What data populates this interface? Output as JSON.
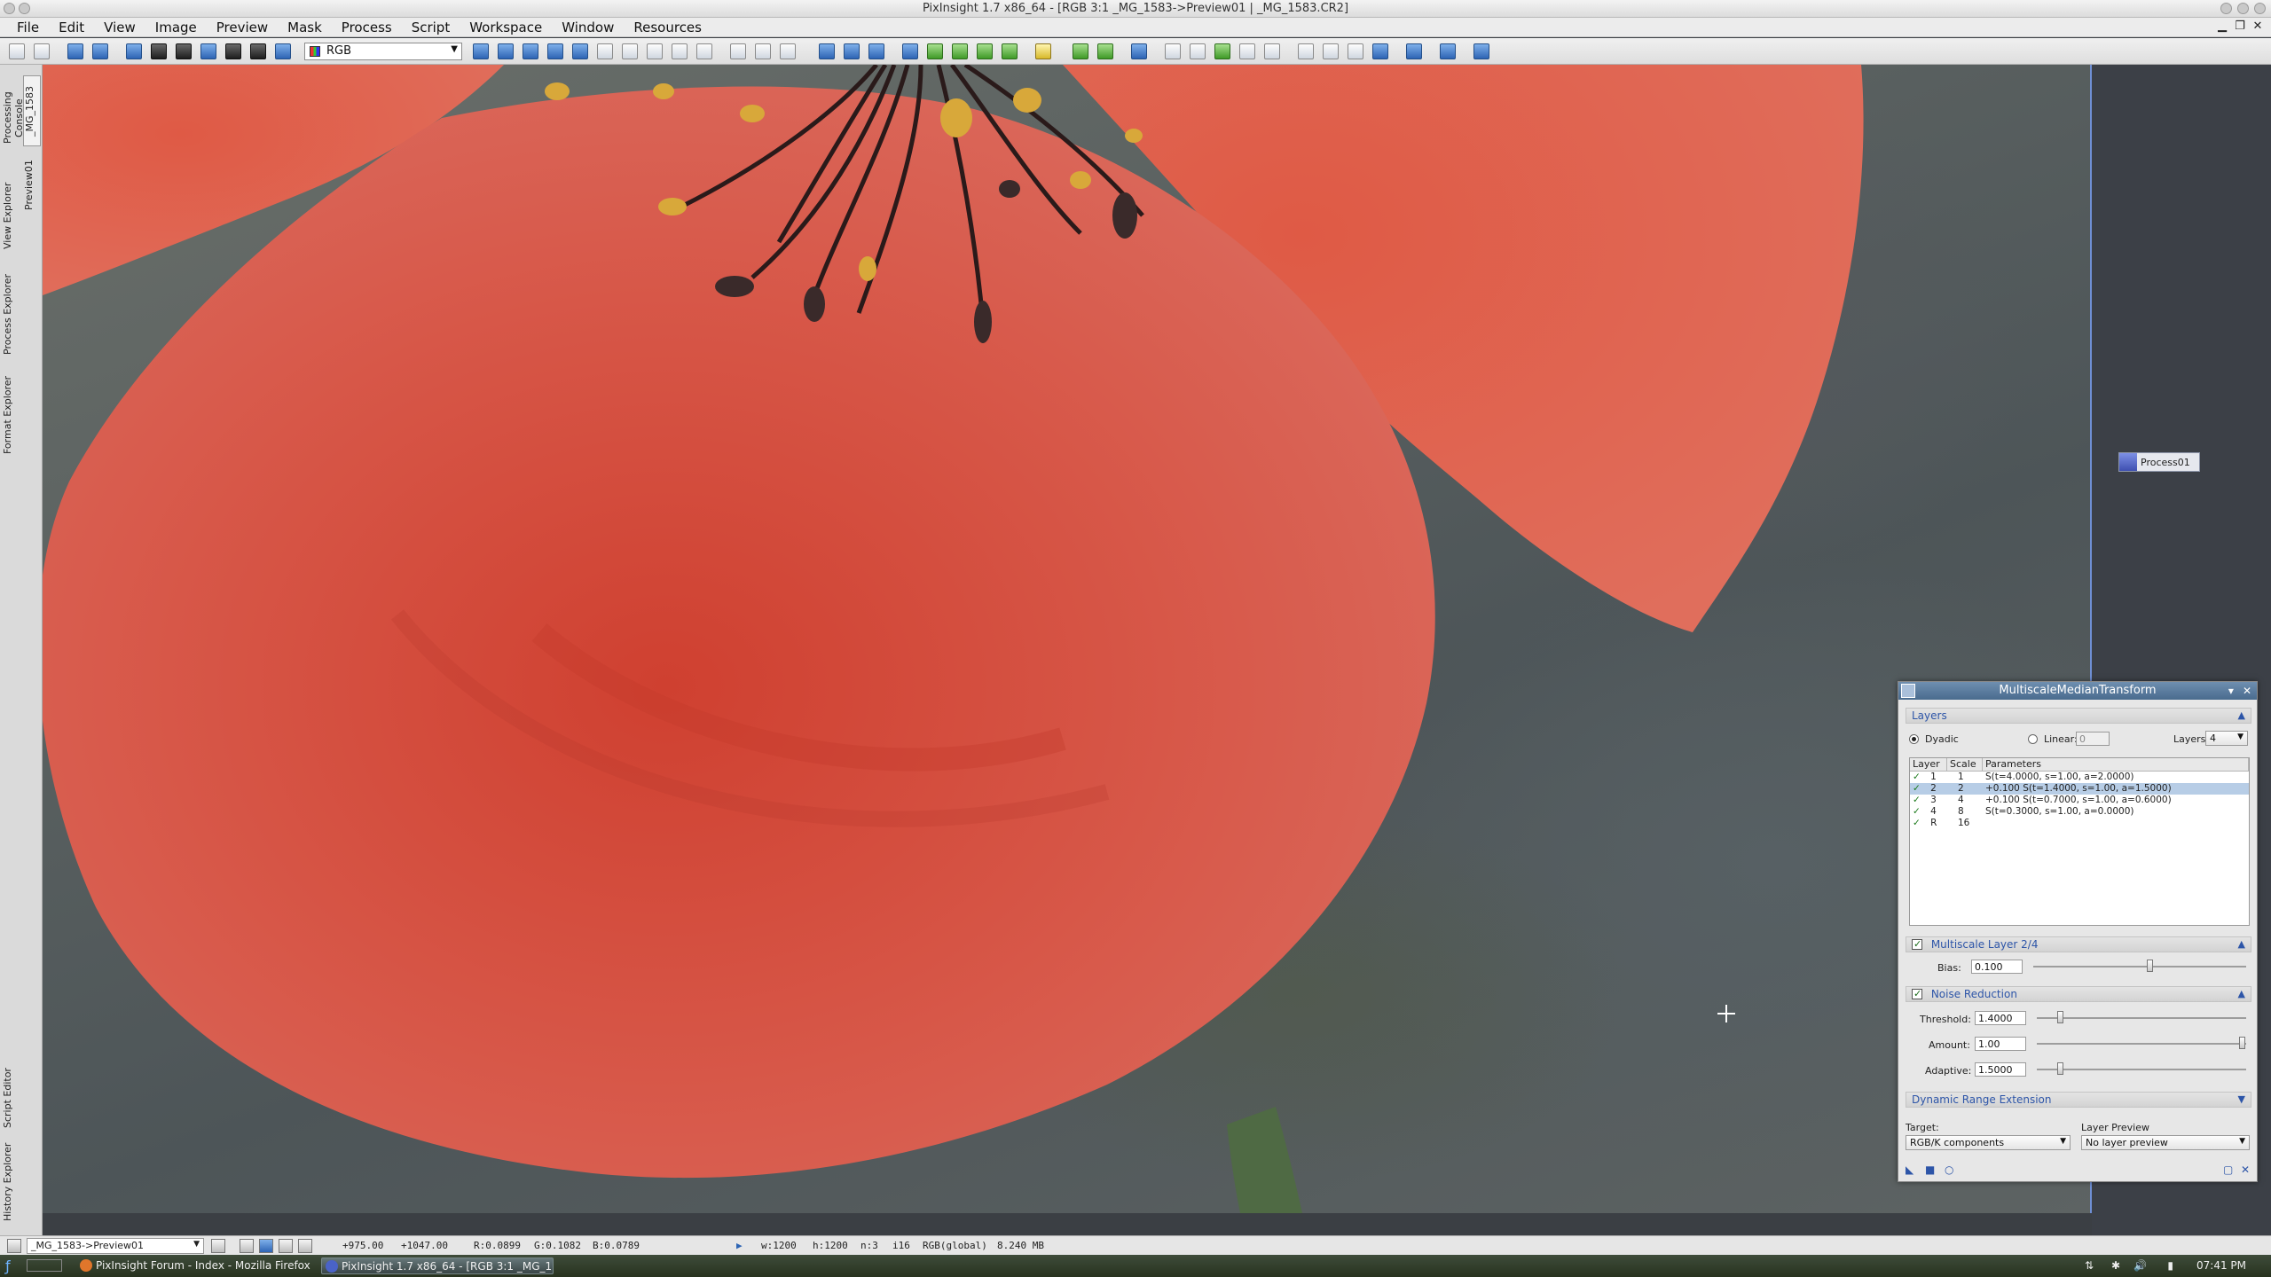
{
  "window": {
    "title": "PixInsight 1.7 x86_64 - [RGB 3:1 _MG_1583->Preview01 | _MG_1583.CR2]"
  },
  "menubar": {
    "items": [
      "File",
      "Edit",
      "View",
      "Image",
      "Preview",
      "Mask",
      "Process",
      "Script",
      "Workspace",
      "Window",
      "Resources"
    ]
  },
  "toolbar": {
    "channel_select": "RGB"
  },
  "left_tabs": {
    "processing_console": "Processing Console",
    "view_explorer": "View Explorer",
    "process_explorer": "Process Explorer",
    "format_explorer": "Format Explorer",
    "script_editor": "Script Editor",
    "history_explorer": "History Explorer",
    "doc_tab": "_MG_1583",
    "preview_tab": "Preview01"
  },
  "workspace": {
    "process_icon_label": "Process01"
  },
  "mmt": {
    "title": "MultiscaleMedianTransform",
    "layers_section": "Layers",
    "dyadic_label": "Dyadic",
    "linear_label": "Linear:",
    "linear_value": "0",
    "layers_label": "Layers:",
    "layers_value": "4",
    "table_headers": [
      "Layer",
      "Scale",
      "Parameters"
    ],
    "table_rows": [
      {
        "check": "✓",
        "layer": "1",
        "scale": "1",
        "params": "S(t=4.0000, s=1.00, a=2.0000)"
      },
      {
        "check": "✓",
        "layer": "2",
        "scale": "2",
        "params": "+0.100 S(t=1.4000, s=1.00, a=1.5000)"
      },
      {
        "check": "✓",
        "layer": "3",
        "scale": "4",
        "params": "+0.100 S(t=0.7000, s=1.00, a=0.6000)"
      },
      {
        "check": "✓",
        "layer": "4",
        "scale": "8",
        "params": "S(t=0.3000, s=1.00, a=0.0000)"
      },
      {
        "check": "✓",
        "layer": "R",
        "scale": "16",
        "params": ""
      }
    ],
    "selected_row": 1,
    "multiscale_layer_section": "Multiscale Layer 2/4",
    "bias_label": "Bias:",
    "bias_value": "0.100",
    "bias_level": 0.55,
    "noise_reduction_section": "Noise Reduction",
    "threshold_label": "Threshold:",
    "threshold_value": "1.4000",
    "threshold_level": 0.1,
    "amount_label": "Amount:",
    "amount_value": "1.00",
    "amount_level": 1.0,
    "adaptive_label": "Adaptive:",
    "adaptive_value": "1.5000",
    "adaptive_level": 0.1,
    "dre_section": "Dynamic Range Extension",
    "target_label": "Target:",
    "target_value": "RGB/K components",
    "layer_preview_label": "Layer Preview",
    "layer_preview_value": "No layer preview"
  },
  "statusbar": {
    "view": "_MG_1583->Preview01",
    "x": "+975.00",
    "y": "+1047.00",
    "r": "R:0.0899",
    "g": "G:0.1082",
    "b": "B:0.0789",
    "w": "w:1200",
    "h": "h:1200",
    "n": "n:3",
    "bits": "i16",
    "colorspace": "RGB(global)",
    "size": "8.240 MB"
  },
  "taskbar": {
    "task1": "PixInsight Forum - Index - Mozilla Firefox",
    "task2": "PixInsight 1.7 x86_64 - [RGB 3:1 _MG_1",
    "clock": "07:41 PM"
  },
  "colors": {
    "accent": "#2d55a8",
    "petal": "#d9584a",
    "selection": "#b7cde6"
  }
}
